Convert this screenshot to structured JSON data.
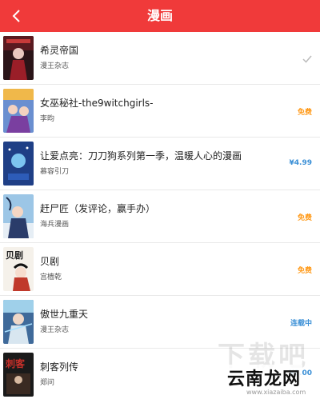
{
  "header": {
    "title": "漫画",
    "back_icon": "chevron-left-icon"
  },
  "colors": {
    "header_bg": "#f03a3a",
    "free": "#ff9a1a",
    "price": "#3a8fd6",
    "serial": "#3a8fd6",
    "owned": "#bbbbbb"
  },
  "items": [
    {
      "title": "希灵帝国",
      "author": "漫王杂志",
      "status": "",
      "status_type": "owned"
    },
    {
      "title": "女巫秘社-the9witchgirls-",
      "author": "李昀",
      "status": "免费",
      "status_type": "free"
    },
    {
      "title": "让爱点亮：刀刀狗系列第一季，温暖人心的漫画",
      "author": "慕容引刀",
      "status": "¥4.99",
      "status_type": "price"
    },
    {
      "title": "赶尸匠（发评论，赢手办）",
      "author": "海兵漫画",
      "status": "免费",
      "status_type": "free"
    },
    {
      "title": "贝剧",
      "author": "宫樯乾",
      "status": "免费",
      "status_type": "free"
    },
    {
      "title": "傲世九重天",
      "author": "漫王杂志",
      "status": "连载中",
      "status_type": "serial"
    },
    {
      "title": "刺客列传",
      "author": "郑问",
      "status": "¥8.00",
      "status_type": "price"
    }
  ],
  "watermark": {
    "brand": "云南龙网",
    "big": "下载吧",
    "url": "www.xiazaiba.com"
  }
}
